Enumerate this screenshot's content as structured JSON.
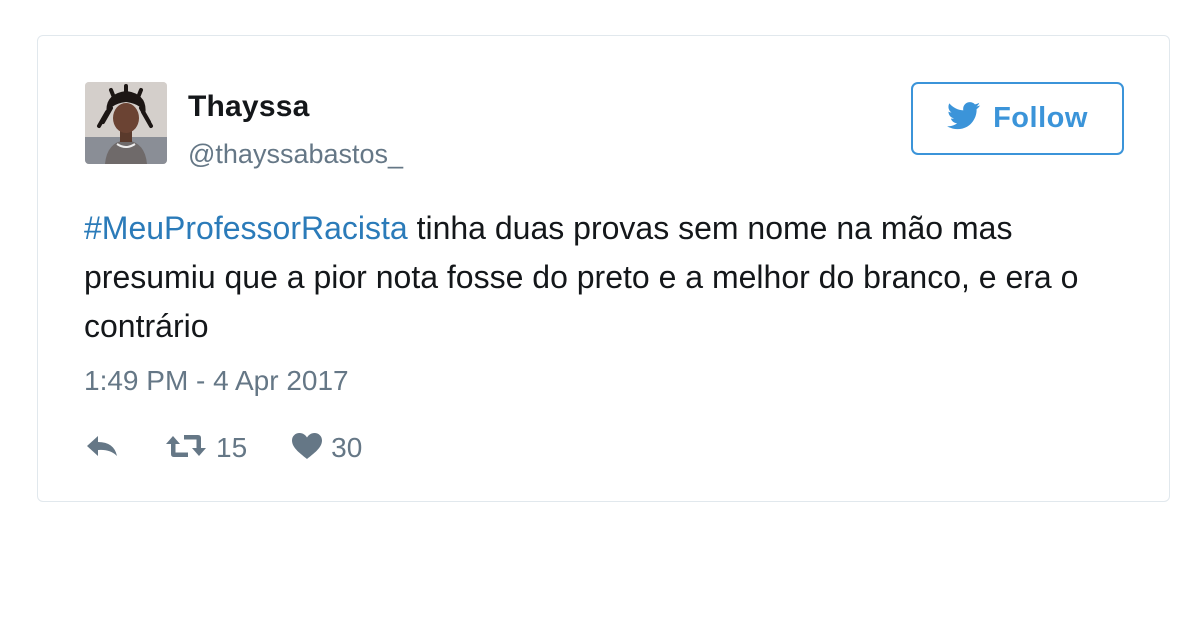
{
  "tweet": {
    "author": {
      "display_name": "Thayssa",
      "handle": "@thayssabastos_",
      "avatar_icon": "profile-photo"
    },
    "follow_button": {
      "label": "Follow",
      "icon": "twitter-bird-icon"
    },
    "text": {
      "hashtag": "#MeuProfessorRacista",
      "body": " tinha duas provas sem nome na mão mas presumiu que a pior nota fosse do preto e a melhor do branco, e era o contrário"
    },
    "timestamp": "1:49 PM - 4 Apr 2017",
    "actions": {
      "reply_icon": "reply-icon",
      "retweet_icon": "retweet-icon",
      "retweet_count": "15",
      "like_icon": "heart-icon",
      "like_count": "30"
    }
  },
  "colors": {
    "brand_blue": "#3b94d9",
    "hashtag_blue": "#2b7bb9",
    "text": "#14171a",
    "muted": "#657786",
    "border": "#e1e8ed"
  }
}
